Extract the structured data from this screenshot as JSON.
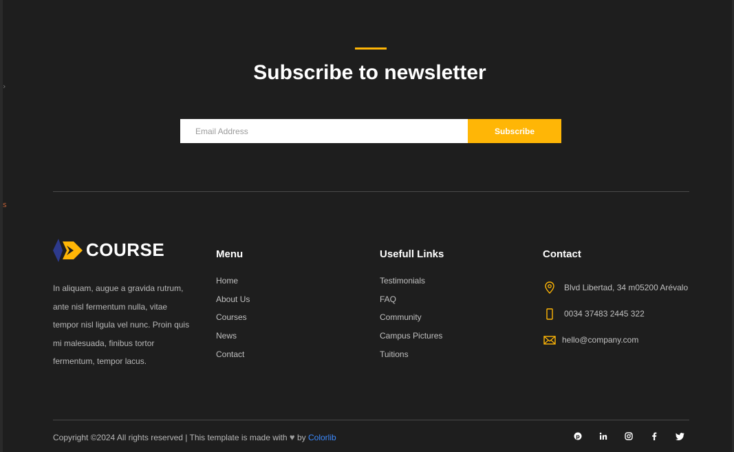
{
  "newsletter": {
    "title": "Subscribe to newsletter",
    "email_placeholder": "Email Address",
    "subscribe_label": "Subscribe"
  },
  "brand": {
    "name": "COURSE",
    "description": "In aliquam, augue a gravida rutrum, ante nisl fermentum nulla, vitae tempor nisl ligula vel nunc. Proin quis mi malesuada, finibus tortor fermentum, tempor lacus."
  },
  "menu": {
    "title": "Menu",
    "items": [
      "Home",
      "About Us",
      "Courses",
      "News",
      "Contact"
    ]
  },
  "useful_links": {
    "title": "Usefull Links",
    "items": [
      "Testimonials",
      "FAQ",
      "Community",
      "Campus Pictures",
      "Tuitions"
    ]
  },
  "contact": {
    "title": "Contact",
    "address": "Blvd Libertad, 34 m05200 Arévalo",
    "phone": "0034 37483 2445 322",
    "email": "hello@company.com"
  },
  "footer": {
    "copyright_text": "Copyright ©2024 All rights reserved | This template is made with",
    "by_text": "by",
    "author_link": "Colorlib",
    "social": [
      "pinterest-icon",
      "linkedin-icon",
      "instagram-icon",
      "facebook-icon",
      "twitter-icon"
    ]
  },
  "colors": {
    "background": "#1e1e1e",
    "accent": "#ffb606",
    "link": "#3d8bff"
  }
}
